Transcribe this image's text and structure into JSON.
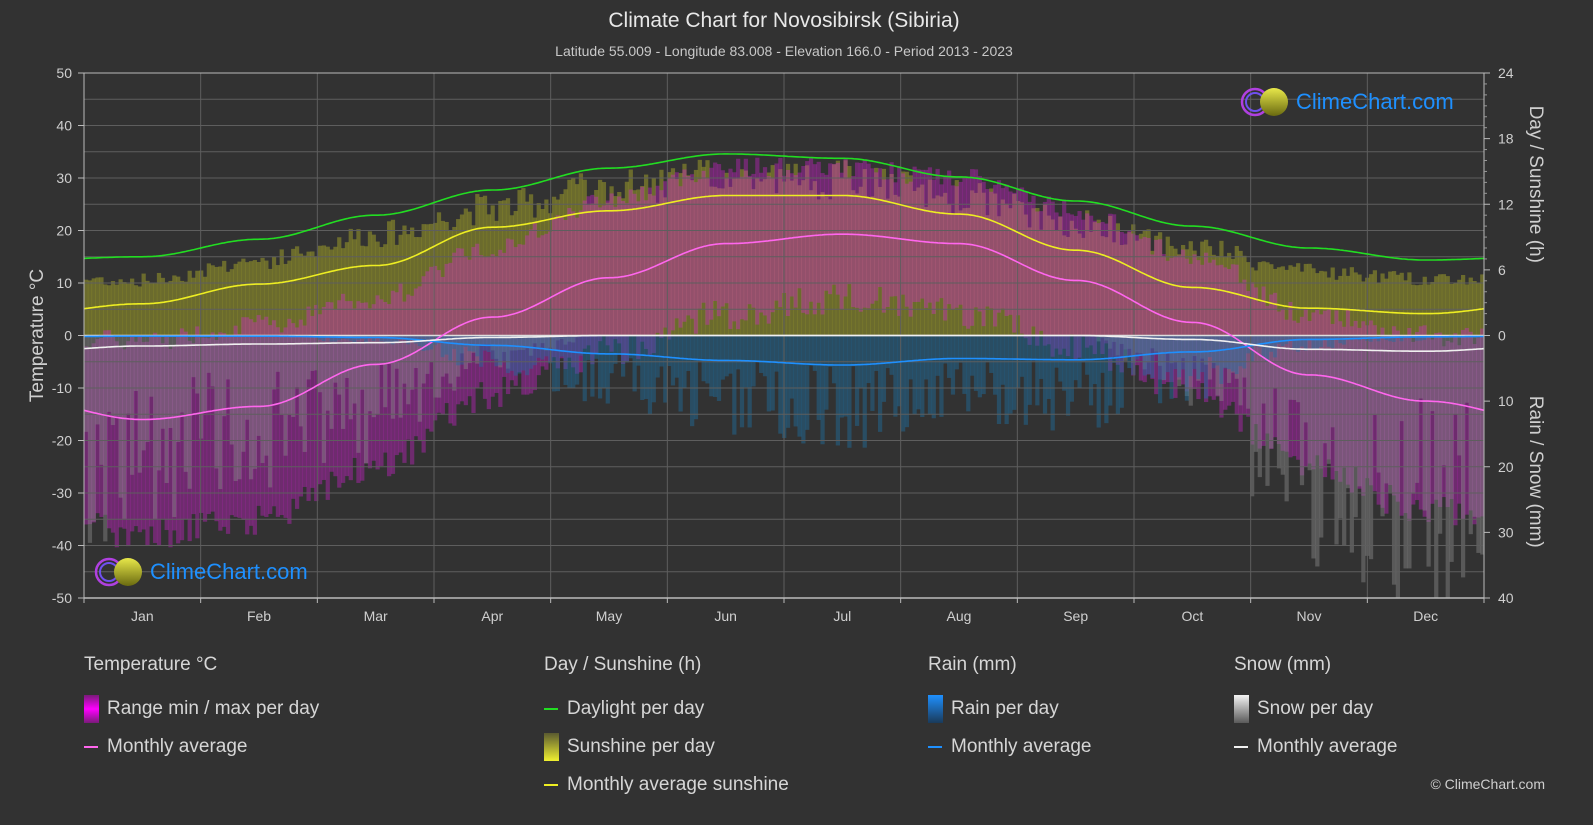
{
  "header": {
    "title": "Climate Chart for Novosibirsk (Sibiria)",
    "subtitle": "Latitude 55.009 - Longitude 83.008 - Elevation 166.0 - Period 2013 - 2023"
  },
  "logo_text": "ClimeChart.com",
  "copyright": "© ClimeChart.com",
  "colors": {
    "background": "#323232",
    "temperature_avg": "#ff66ee",
    "temperature_range": "#e020e0",
    "daylight": "#22dd22",
    "sunshine_avg": "#eeee22",
    "sunshine_bar": "#9a9a2a",
    "rain_avg": "#1e90ff",
    "rain_bar": "#1e6ea0",
    "snow_avg": "#f0f0f0",
    "snow_bar": "#8a8a8a",
    "logo_text": "#1e90ff"
  },
  "legend": {
    "temperature": {
      "title": "Temperature °C",
      "range": "Range min / max per day",
      "avg": "Monthly average"
    },
    "sunshine": {
      "title": "Day / Sunshine (h)",
      "daylight": "Daylight per day",
      "sunshine": "Sunshine per day",
      "avg": "Monthly average sunshine"
    },
    "rain": {
      "title": "Rain (mm)",
      "per_day": "Rain per day",
      "avg": "Monthly average"
    },
    "snow": {
      "title": "Snow (mm)",
      "per_day": "Snow per day",
      "avg": "Monthly average"
    }
  },
  "chart_data": {
    "type": "line",
    "title": "Climate Chart for Novosibirsk (Sibiria)",
    "categories": [
      "Jan",
      "Feb",
      "Mar",
      "Apr",
      "May",
      "Jun",
      "Jul",
      "Aug",
      "Sep",
      "Oct",
      "Nov",
      "Dec"
    ],
    "y_left": {
      "label": "Temperature °C",
      "range": [
        -50,
        50
      ],
      "ticks": [
        50,
        40,
        30,
        20,
        10,
        0,
        -10,
        -20,
        -30,
        -40,
        -50
      ]
    },
    "y_right_top": {
      "label": "Day / Sunshine (h)",
      "range": [
        0,
        24
      ],
      "ticks": [
        24,
        18,
        12,
        6,
        0
      ]
    },
    "y_right_bottom": {
      "label": "Rain / Snow (mm)",
      "range": [
        0,
        40
      ],
      "ticks": [
        0,
        10,
        20,
        30,
        40
      ]
    },
    "grid": true,
    "series": [
      {
        "name": "Temperature monthly average",
        "axis": "left",
        "values": [
          -16,
          -13.5,
          -5.5,
          3.5,
          11,
          17.5,
          19.3,
          17.5,
          10.5,
          2.5,
          -7.5,
          -12.5
        ]
      },
      {
        "name": "Temperature range min",
        "axis": "left",
        "values": [
          -35,
          -32,
          -22,
          -8,
          0,
          7,
          10,
          7,
          1,
          -8,
          -22,
          -30
        ]
      },
      {
        "name": "Temperature range max",
        "axis": "left",
        "values": [
          -3,
          0,
          5,
          15,
          24,
          30,
          30,
          28,
          22,
          13,
          2,
          -2
        ]
      },
      {
        "name": "Daylight per day",
        "axis": "right_top",
        "values": [
          7.2,
          8.8,
          11.0,
          13.3,
          15.3,
          16.6,
          16.2,
          14.5,
          12.3,
          10.0,
          8.0,
          6.9
        ]
      },
      {
        "name": "Sunshine per day (max)",
        "axis": "right_top",
        "values": [
          5.2,
          7.0,
          9.5,
          12.0,
          13.8,
          14.8,
          14.6,
          13.0,
          10.5,
          8.2,
          6.0,
          5.3
        ]
      },
      {
        "name": "Monthly average sunshine",
        "axis": "right_top",
        "values": [
          2.9,
          4.7,
          6.4,
          9.9,
          11.4,
          12.8,
          12.8,
          11.1,
          7.8,
          4.4,
          2.5,
          2.0
        ]
      },
      {
        "name": "Rain monthly average",
        "axis": "right_bottom",
        "values": [
          0.1,
          0.1,
          0.3,
          1.5,
          2.8,
          3.8,
          4.5,
          3.5,
          3.7,
          2.5,
          0.6,
          0.2
        ]
      },
      {
        "name": "Snow monthly average",
        "axis": "right_bottom",
        "values": [
          1.6,
          1.3,
          1.1,
          0.3,
          0,
          0,
          0,
          0,
          0,
          0.6,
          2.1,
          2.4
        ]
      }
    ]
  }
}
